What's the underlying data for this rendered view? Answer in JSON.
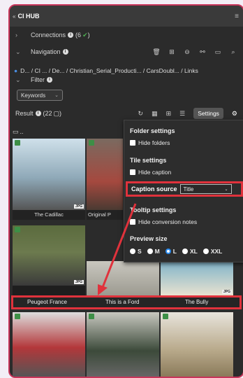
{
  "header": {
    "title": "CI HUB"
  },
  "sections": {
    "connections": {
      "label": "Connections",
      "count": "(6"
    },
    "navigation": {
      "label": "Navigation"
    },
    "filter": {
      "label": "Filter"
    }
  },
  "breadcrumb": [
    "D...",
    "CI ...",
    "De...",
    "Christian_Serial_Producti...",
    "CarsDoubl...",
    "Links"
  ],
  "filter": {
    "keywords_label": "Keywords"
  },
  "result": {
    "label": "Result",
    "count": "(22",
    "tooltip": "Settings"
  },
  "folder_up": "..",
  "tiles": [
    {
      "caption": "The Cadillac",
      "color": "#8fa9b8"
    },
    {
      "caption": "Original P",
      "color": "#a5493f"
    },
    {
      "caption": "",
      "color": "#556"
    },
    {
      "caption": "",
      "color": "#6a6a70"
    },
    {
      "caption": "Peugeot France",
      "color": "#6c7a4e"
    },
    {
      "caption": "This is a Ford",
      "color": "#9c9a90"
    },
    {
      "caption": "The Bully",
      "color": "#7fb3c9"
    },
    {
      "caption": "",
      "color": "#b3373a"
    },
    {
      "caption": "",
      "color": "#3c4a3a"
    },
    {
      "caption": "",
      "color": "#b7a889"
    }
  ],
  "settings_panel": {
    "folder_settings": "Folder settings",
    "hide_folders": "Hide folders",
    "tile_settings": "Tile settings",
    "hide_caption": "Hide caption",
    "caption_source": "Caption source",
    "caption_value": "Title",
    "tooltip_settings": "Tooltip settings",
    "hide_conversion": "Hide conversion notes",
    "preview_size": "Preview size",
    "sizes": [
      "S",
      "M",
      "L",
      "XL",
      "XXL"
    ],
    "selected_size": "L"
  },
  "colors": {
    "accent": "#e0323c",
    "selected_radio": "#2a8cf0",
    "frame": "#c9355b"
  }
}
